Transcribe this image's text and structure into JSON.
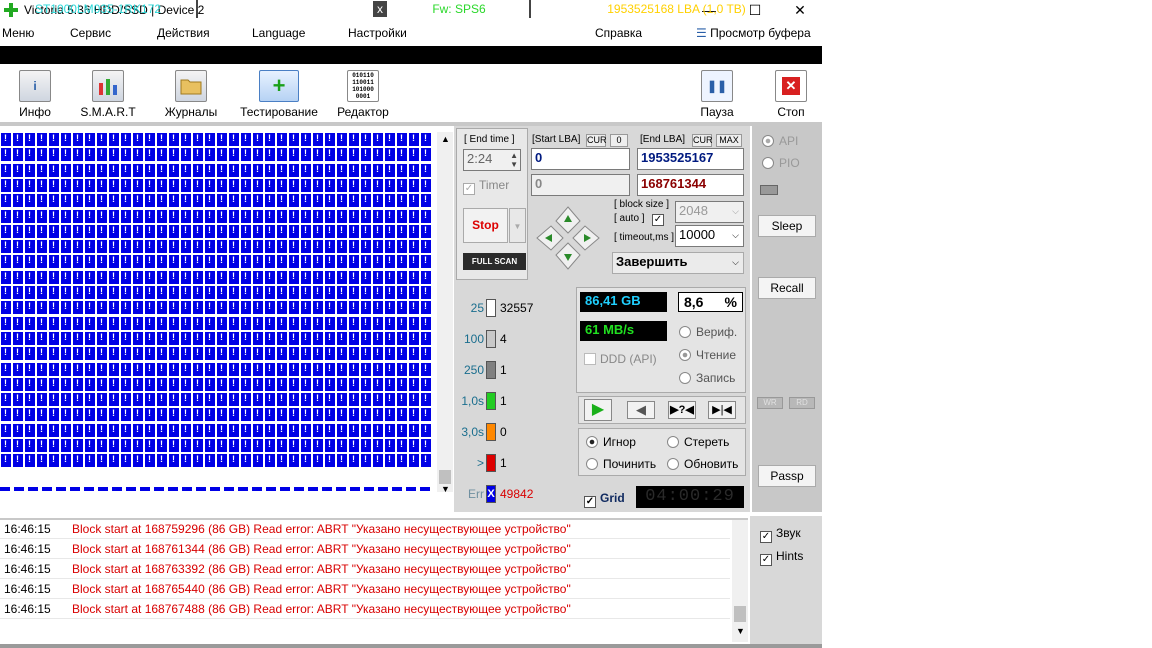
{
  "window": {
    "title": "Victoria 5.36 HDD/SSD | Device 2",
    "minimize": "—",
    "maximize": "☐",
    "close": "✕"
  },
  "menu": [
    "Меню",
    "Сервис",
    "Действия",
    "Language",
    "Настройки",
    "Справка"
  ],
  "clipboard": "Просмотр буфера",
  "info": {
    "model": "ST1000LM035-1RK172",
    "serial": "SN: WL1YXN7K",
    "close": "x",
    "firmware": "Fw: SPS6",
    "lba": "1953525168 LBA (1,0 TB)"
  },
  "toolbar": {
    "info": "Инфо",
    "smart": "S.M.A.R.T",
    "journals": "Журналы",
    "testing": "Тестирование",
    "editor": "Редактор",
    "pause": "Пауза",
    "stop": "Стоп"
  },
  "scan": {
    "end_time_label": "[ End time ]",
    "end_time": "2:24",
    "start_lba_label": "[Start LBA]",
    "cur": "CUR",
    "start_zero": "0",
    "start_lba": "0",
    "end_lba_label": "[End LBA]",
    "max": "MAX",
    "end_lba": "1953525167",
    "timer_label": "Timer",
    "timer_value": "0",
    "current_lba": "168761344",
    "block_size_label": "[ block size ]",
    "auto_label": "[ auto ]",
    "block_size": "2048",
    "timeout_label": "[ timeout,ms ]",
    "timeout": "10000",
    "stop_button": "Stop",
    "full_scan": "FULL SCAN",
    "finish": "Завершить"
  },
  "legend": [
    {
      "ms": "25",
      "count": "32557",
      "color": "#ffffff"
    },
    {
      "ms": "100",
      "count": "4",
      "color": "#c8c8c8"
    },
    {
      "ms": "250",
      "count": "1",
      "color": "#808080"
    },
    {
      "ms": "1,0s",
      "count": "1",
      "color": "#22cc22"
    },
    {
      "ms": "3,0s",
      "count": "0",
      "color": "#ff8800"
    },
    {
      "ms": ">",
      "count": "1",
      "color": "#dd0000"
    },
    {
      "ms": "Err",
      "count": "49842",
      "color": "#0000e6"
    }
  ],
  "stats": {
    "size": "86,41 GB",
    "percent": "8,6",
    "pct_sign": "%",
    "speed": "61 MB/s",
    "ddd": "DDD (API)",
    "verify": "Вериф.",
    "read": "Чтение",
    "write": "Запись"
  },
  "actions": {
    "ignore": "Игнор",
    "erase": "Стереть",
    "repair": "Починить",
    "refresh": "Обновить",
    "grid": "Grid",
    "grid_time": "04:00:29"
  },
  "side": {
    "api": "API",
    "pio": "PIO",
    "sleep": "Sleep",
    "recall": "Recall",
    "wr": "WR",
    "rd": "RD",
    "passp": "Passp",
    "sound": "Звук",
    "hints": "Hints"
  },
  "log": [
    {
      "time": "16:46:15",
      "msg": "Block start at 168759296 (86 GB) Read error: ABRT \"Указано несуществующее устройство\""
    },
    {
      "time": "16:46:15",
      "msg": "Block start at 168761344 (86 GB) Read error: ABRT \"Указано несуществующее устройство\""
    },
    {
      "time": "16:46:15",
      "msg": "Block start at 168763392 (86 GB) Read error: ABRT \"Указано несуществующее устройство\""
    },
    {
      "time": "16:46:15",
      "msg": "Block start at 168765440 (86 GB) Read error: ABRT \"Указано несуществующее устройство\""
    },
    {
      "time": "16:46:15",
      "msg": "Block start at 168767488 (86 GB) Read error: ABRT \"Указано несуществующее устройство\""
    }
  ]
}
